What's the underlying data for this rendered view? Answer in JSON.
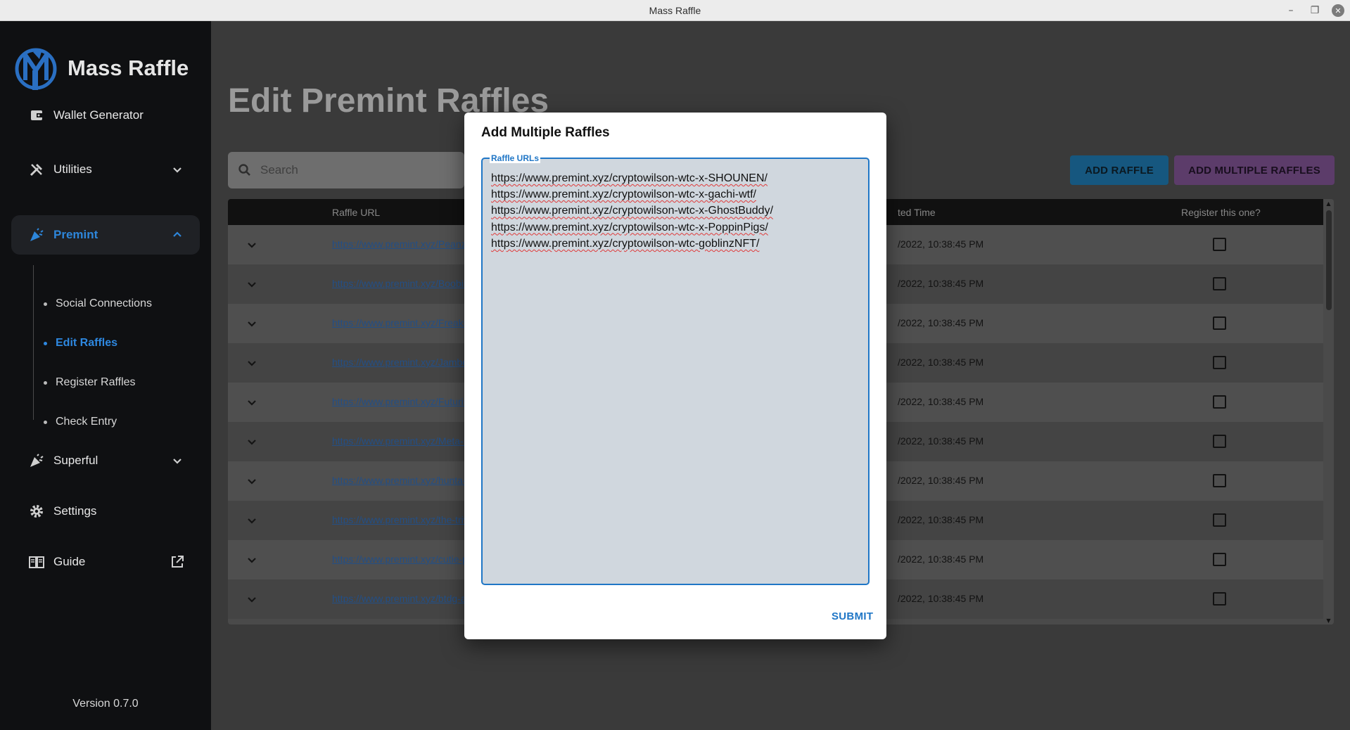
{
  "window": {
    "title": "Mass Raffle",
    "controls": [
      "minimize",
      "maximize",
      "close"
    ]
  },
  "sidebar": {
    "brand": "Mass Raffle",
    "nav": [
      {
        "label": "Wallet Generator",
        "icon": "wallet-icon"
      },
      {
        "label": "Utilities",
        "icon": "tools-icon",
        "expandable": true,
        "expanded": false
      },
      {
        "label": "Premint",
        "icon": "party-popper-icon",
        "expandable": true,
        "expanded": true,
        "active": true
      },
      {
        "label": "Superful",
        "icon": "party-popper-icon",
        "expandable": true,
        "expanded": false
      },
      {
        "label": "Settings",
        "icon": "gear-icon"
      },
      {
        "label": "Guide",
        "icon": "book-icon",
        "external": true
      }
    ],
    "premint_sub": [
      {
        "label": "Social Connections"
      },
      {
        "label": "Edit Raffles",
        "active": true
      },
      {
        "label": "Register Raffles"
      },
      {
        "label": "Check Entry"
      }
    ],
    "version": "Version 0.7.0"
  },
  "main": {
    "title": "Edit Premint Raffles",
    "search": {
      "placeholder": "Search",
      "value": ""
    },
    "buttons": {
      "add": "ADD RAFFLE",
      "add_multiple": "ADD MULTIPLE RAFFLES"
    },
    "table": {
      "headers": {
        "url": "Raffle URL",
        "time": "ted Time",
        "register": "Register this one?"
      },
      "rows": [
        {
          "url": "https://www.premint.xyz/Peanz/",
          "time": "/2022, 10:38:45 PM",
          "checked": false
        },
        {
          "url": "https://www.premint.xyz/Boobird",
          "time": "/2022, 10:38:45 PM",
          "checked": false
        },
        {
          "url": "https://www.premint.xyz/Freaks/",
          "time": "/2022, 10:38:45 PM",
          "checked": false
        },
        {
          "url": "https://www.premint.xyz/Jambe",
          "time": "/2022, 10:38:45 PM",
          "checked": false
        },
        {
          "url": "https://www.premint.xyz/Futurist",
          "time": "/2022, 10:38:45 PM",
          "checked": false
        },
        {
          "url": "https://www.premint.xyz/Meta-N",
          "time": "/2022, 10:38:45 PM",
          "checked": false
        },
        {
          "url": "https://www.premint.xyz/hunta-C",
          "time": "/2022, 10:38:45 PM",
          "checked": false
        },
        {
          "url": "https://www.premint.xyz/the-trive",
          "time": "/2022, 10:38:45 PM",
          "checked": false
        },
        {
          "url": "https://www.premint.xyz/cutie-pe",
          "time": "/2022, 10:38:45 PM",
          "checked": false
        },
        {
          "url": "https://www.premint.xyz/btdg-aa",
          "time": "/2022, 10:38:45 PM",
          "checked": false
        }
      ]
    }
  },
  "modal": {
    "title": "Add Multiple Raffles",
    "field_label": "Raffle URLs",
    "lines": [
      "https://www.premint.xyz/cryptowilson-wtc-x-SHOUNEN/",
      "https://www.premint.xyz/cryptowilson-wtc-x-gachi-wtf/",
      "https://www.premint.xyz/cryptowilson-wtc-x-GhostBuddy/",
      "https://www.premint.xyz/cryptowilson-wtc-x-PoppinPigs/",
      "https://www.premint.xyz/cryptowilson-wtc-goblinzNFT/"
    ],
    "submit": "SUBMIT"
  },
  "colors": {
    "accent": "#1f76c6",
    "add_button": "#16577f",
    "add_multiple_button": "#5c3c6a",
    "sidebar": "#0f1012"
  }
}
